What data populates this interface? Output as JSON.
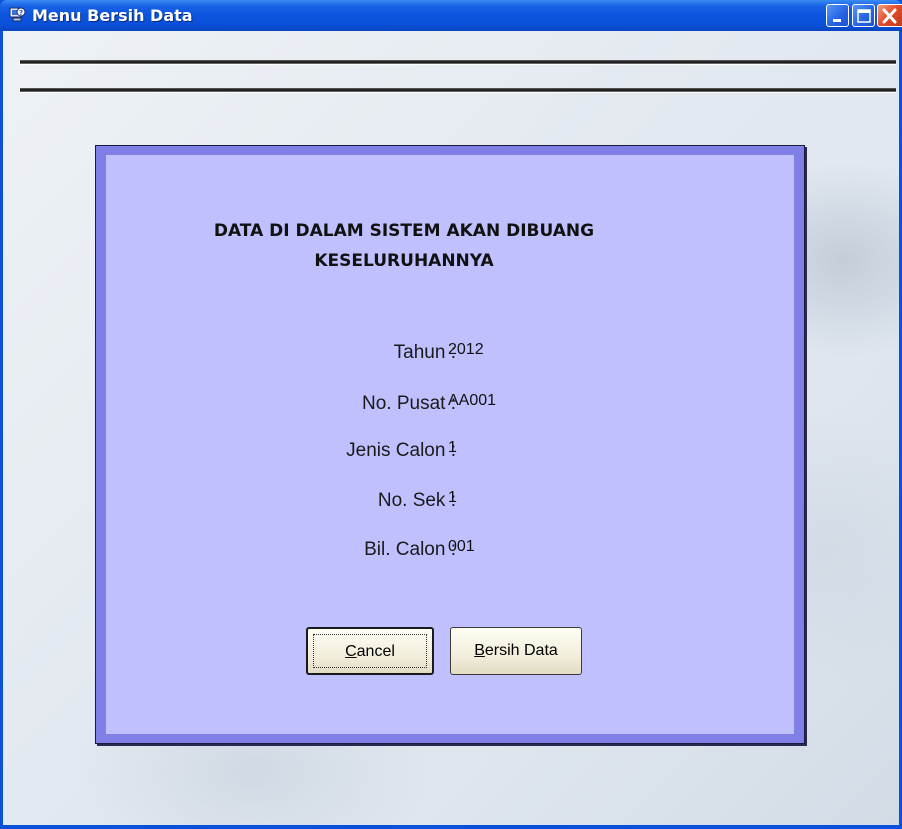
{
  "window": {
    "title": "Menu Bersih Data",
    "app_icon": "help-computer-icon",
    "controls": [
      "minimize-icon",
      "maximize-icon",
      "close-icon"
    ]
  },
  "dialog": {
    "heading_line1": "DATA DI DALAM SISTEM AKAN DIBUANG",
    "heading_line2": "KESELURUHANNYA",
    "fields": [
      {
        "label": "Tahun :",
        "value": "2012"
      },
      {
        "label": "No. Pusat :",
        "value": "AA001"
      },
      {
        "label": "Jenis Calon :",
        "value": "1"
      },
      {
        "label": "No. Sek :",
        "value": "1"
      },
      {
        "label": "Bil. Calon :",
        "value": "001"
      }
    ],
    "buttons": {
      "cancel_mnemonic": "C",
      "cancel_rest": "ancel",
      "bersih_mnemonic": "B",
      "bersih_rest": "ersih Data"
    }
  },
  "colors": {
    "titlebar": "#0b51d9",
    "panel_border": "#7f7fe6",
    "panel_fill": "#c0c0ff"
  }
}
